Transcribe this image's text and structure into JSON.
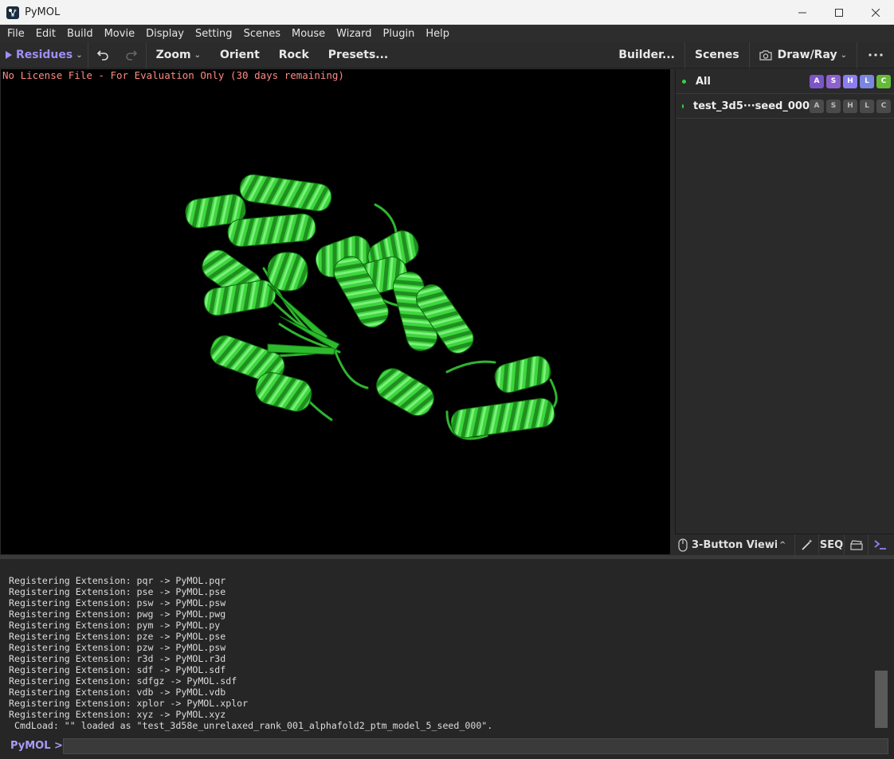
{
  "window": {
    "title": "PyMOL"
  },
  "menu": [
    "File",
    "Edit",
    "Build",
    "Movie",
    "Display",
    "Setting",
    "Scenes",
    "Mouse",
    "Wizard",
    "Plugin",
    "Help"
  ],
  "toolbar": {
    "residues": "Residues",
    "zoom": "Zoom",
    "orient": "Orient",
    "rock": "Rock",
    "presets": "Presets...",
    "builder": "Builder...",
    "scenes": "Scenes",
    "draw_ray": "Draw/Ray"
  },
  "viewport": {
    "license_text": "No License File - For Evaluation Only (30 days remaining)"
  },
  "objects": [
    {
      "name": "All",
      "badges": [
        "A",
        "S",
        "H",
        "L",
        "C"
      ]
    },
    {
      "name": "test_3d5···seed_000",
      "badges": [
        "A",
        "S",
        "H",
        "L",
        "C"
      ]
    }
  ],
  "bottom_bar": {
    "mouse_mode": "3-Button Viewing",
    "seq": "SEQ"
  },
  "console": {
    "lines": [
      "Registering Extension: pqr -> PyMOL.pqr",
      "Registering Extension: pse -> PyMOL.pse",
      "Registering Extension: psw -> PyMOL.psw",
      "Registering Extension: pwg -> PyMOL.pwg",
      "Registering Extension: pym -> PyMOL.py",
      "Registering Extension: pze -> PyMOL.pse",
      "Registering Extension: pzw -> PyMOL.psw",
      "Registering Extension: r3d -> PyMOL.r3d",
      "Registering Extension: sdf -> PyMOL.sdf",
      "Registering Extension: sdfgz -> PyMOL.sdf",
      "Registering Extension: vdb -> PyMOL.vdb",
      "Registering Extension: xplor -> PyMOL.xplor",
      "Registering Extension: xyz -> PyMOL.xyz",
      " CmdLoad: \"\" loaded as \"test_3d58e_unrelaxed_rank_001_alphafold2_ptm_model_5_seed_000\"."
    ],
    "prompt": "PyMOL >",
    "input_value": ""
  },
  "colors": {
    "accent": "#9d8ff5",
    "cartoon_green": "#33cc33",
    "license_red": "#ff8a80",
    "active_dot": "#34d04a",
    "badge_A": "#7b55c8",
    "badge_S": "#8e61d0",
    "badge_H": "#8c7ef0",
    "badge_L": "#7a86e0",
    "badge_C": "#67b93a",
    "badge_inactive": "#4a4a4a"
  }
}
